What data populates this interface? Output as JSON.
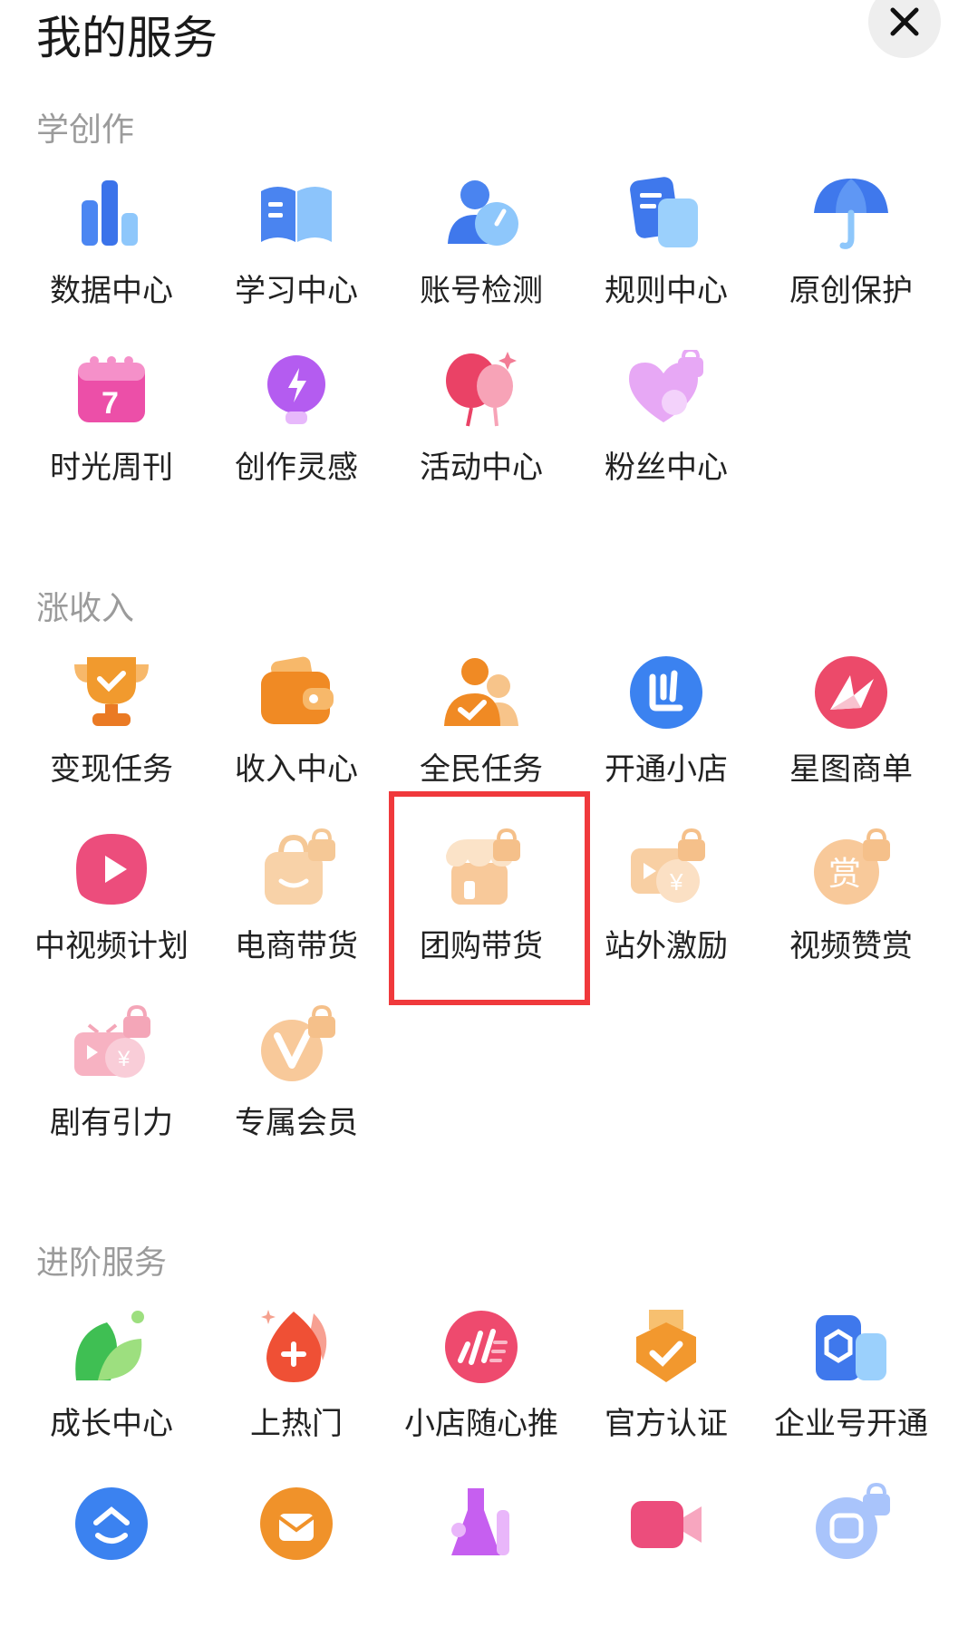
{
  "header": {
    "title": "我的服务",
    "close_icon": "close-icon"
  },
  "sections": [
    {
      "title": "学创作"
    },
    {
      "title": "涨收入"
    },
    {
      "title": "进阶服务"
    }
  ],
  "items": {
    "data_center": {
      "label": "数据中心",
      "icon": "bar-chart-icon"
    },
    "study_center": {
      "label": "学习中心",
      "icon": "book-icon"
    },
    "account_check": {
      "label": "账号检测",
      "icon": "user-gauge-icon"
    },
    "rules_center": {
      "label": "规则中心",
      "icon": "document-icon"
    },
    "original_protect": {
      "label": "原创保护",
      "icon": "umbrella-icon"
    },
    "time_weekly": {
      "label": "时光周刊",
      "icon": "calendar-icon"
    },
    "inspiration": {
      "label": "创作灵感",
      "icon": "lightbulb-icon"
    },
    "activity_center": {
      "label": "活动中心",
      "icon": "balloon-icon"
    },
    "fans_center": {
      "label": "粉丝中心",
      "icon": "heart-lock-icon"
    },
    "monetize_task": {
      "label": "变现任务",
      "icon": "trophy-icon"
    },
    "income_center": {
      "label": "收入中心",
      "icon": "wallet-icon"
    },
    "mass_task": {
      "label": "全民任务",
      "icon": "people-check-icon"
    },
    "open_shop": {
      "label": "开通小店",
      "icon": "shop-logo-icon"
    },
    "star_map": {
      "label": "星图商单",
      "icon": "star-map-icon"
    },
    "mid_video": {
      "label": "中视频计划",
      "icon": "play-icon"
    },
    "ecommerce": {
      "label": "电商带货",
      "icon": "shopping-bag-lock-icon"
    },
    "group_buy": {
      "label": "团购带货",
      "icon": "store-lock-icon"
    },
    "offsite": {
      "label": "站外激励",
      "icon": "video-yuan-lock-icon"
    },
    "video_reward": {
      "label": "视频赞赏",
      "icon": "reward-lock-icon"
    },
    "drama": {
      "label": "剧有引力",
      "icon": "tv-yuan-lock-icon"
    },
    "vip": {
      "label": "专属会员",
      "icon": "v-badge-lock-icon"
    },
    "growth": {
      "label": "成长中心",
      "icon": "leaf-icon"
    },
    "hot": {
      "label": "上热门",
      "icon": "fire-plus-icon"
    },
    "shop_push": {
      "label": "小店随心推",
      "icon": "boost-icon"
    },
    "official_cert": {
      "label": "官方认证",
      "icon": "medal-icon"
    },
    "enterprise": {
      "label": "企业号开通",
      "icon": "enterprise-icon"
    }
  },
  "bottom_row_icons": [
    "cloud-up-icon",
    "envelope-badge-icon",
    "flask-icon",
    "camera-icon",
    "face-lock-icon"
  ]
}
